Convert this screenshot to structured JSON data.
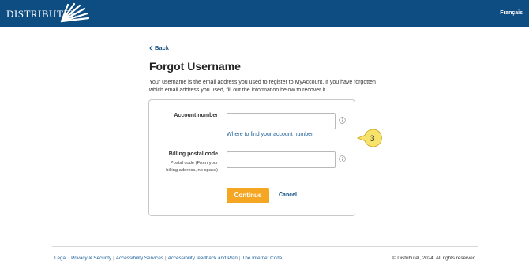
{
  "header": {
    "brand": "DISTRIBUTEL",
    "logo_icon": "sunburst-icon",
    "language_link": "Français",
    "background_color": "#0e4d82"
  },
  "nav": {
    "back_label": "Back",
    "back_icon": "chevron-left-icon"
  },
  "main": {
    "title": "Forgot Username",
    "intro": "Your username is the email address you used to register to MyAccount. If you have forgotten which email address you used, fill out the information below to recover it."
  },
  "form": {
    "account_number": {
      "label": "Account number",
      "value": "",
      "info_icon": "info-icon",
      "help_link": "Where to find your account number"
    },
    "postal_code": {
      "label": "Billing postal code",
      "hint": "Postal code (From your billing address, no space)",
      "value": "",
      "info_icon": "info-icon"
    },
    "continue_label": "Continue",
    "cancel_label": "Cancel",
    "accent_color": "#f5a623"
  },
  "annotation": {
    "step_number": "3",
    "color": "#f7e26b"
  },
  "footer": {
    "links": [
      "Legal",
      "Privacy & Security",
      "Accessibility Services",
      "Accessibility feedback and Plan",
      "The Internet Code"
    ],
    "copyright": "© Distributel, 2024. All rights reserved."
  }
}
